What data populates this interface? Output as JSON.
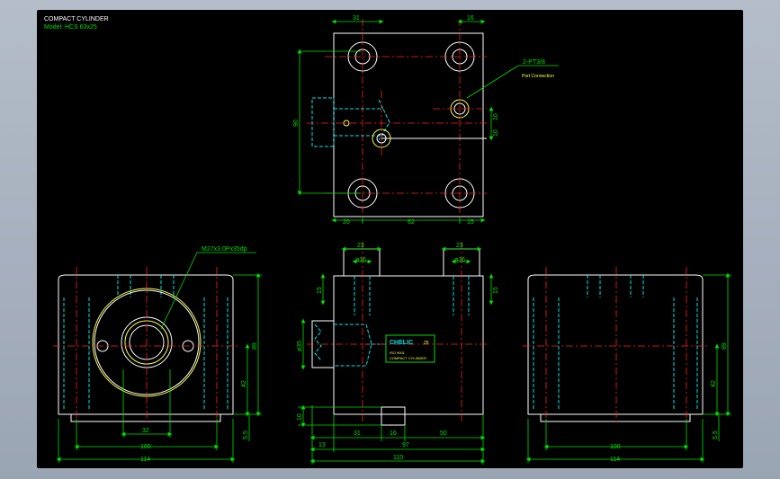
{
  "title_block": {
    "title": "COMPACT CYLINDER",
    "model": "Model: HCS 63x25"
  },
  "top_view": {
    "dims": {
      "top_left": "31",
      "top_right": "16",
      "height": "90",
      "right_10a": "10",
      "right_10b": "10",
      "bottom_20": "20",
      "bottom_62": "62",
      "bottom_15": "15"
    },
    "callout": {
      "label": "2-PT3/8",
      "sub": "Port Connection"
    }
  },
  "front_left_view": {
    "callout": "M27x3.0Px35dp",
    "dims": {
      "w_100": "100",
      "w_114": "114",
      "w_32": "32",
      "h_89": "89",
      "h_42": "42",
      "h_55": "5.5"
    }
  },
  "side_view": {
    "dims": {
      "top_23a": "23",
      "top_23b": "23",
      "dia_16a": "ø16",
      "dia_16b": "ø16",
      "h_15a": "15",
      "h_15b": "15",
      "dia_35": "ø35",
      "h_10": "10",
      "b_13": "13",
      "b_31": "31",
      "b_16": "16",
      "b_50": "50",
      "b_97": "97",
      "b_110": "110"
    },
    "label": {
      "brand": "CHELIC",
      "num": "25",
      "line1": "ISO 9001",
      "line2": "COMPACT CYLINDER"
    }
  },
  "right_view": {
    "dims": {
      "w_100": "100",
      "w_114": "114",
      "h_89": "89",
      "h_42": "42",
      "h_55": "5.5"
    }
  },
  "colors": {
    "geometry": "#ffffff",
    "hidden": "#00e5e5",
    "center": "#ff2020",
    "dim": "#00e000",
    "text": "#e0e000",
    "callout": "#ffff40"
  }
}
